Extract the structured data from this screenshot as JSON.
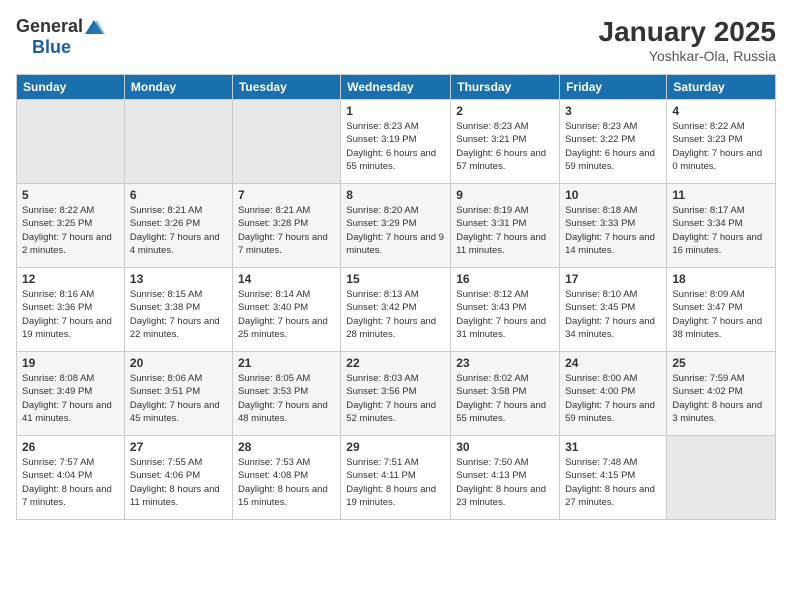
{
  "logo": {
    "general": "General",
    "blue": "Blue"
  },
  "title": "January 2025",
  "subtitle": "Yoshkar-Ola, Russia",
  "days_of_week": [
    "Sunday",
    "Monday",
    "Tuesday",
    "Wednesday",
    "Thursday",
    "Friday",
    "Saturday"
  ],
  "weeks": [
    [
      {
        "day": "",
        "sunrise": "",
        "sunset": "",
        "daylight": ""
      },
      {
        "day": "",
        "sunrise": "",
        "sunset": "",
        "daylight": ""
      },
      {
        "day": "",
        "sunrise": "",
        "sunset": "",
        "daylight": ""
      },
      {
        "day": "1",
        "sunrise": "Sunrise: 8:23 AM",
        "sunset": "Sunset: 3:19 PM",
        "daylight": "Daylight: 6 hours and 55 minutes."
      },
      {
        "day": "2",
        "sunrise": "Sunrise: 8:23 AM",
        "sunset": "Sunset: 3:21 PM",
        "daylight": "Daylight: 6 hours and 57 minutes."
      },
      {
        "day": "3",
        "sunrise": "Sunrise: 8:23 AM",
        "sunset": "Sunset: 3:22 PM",
        "daylight": "Daylight: 6 hours and 59 minutes."
      },
      {
        "day": "4",
        "sunrise": "Sunrise: 8:22 AM",
        "sunset": "Sunset: 3:23 PM",
        "daylight": "Daylight: 7 hours and 0 minutes."
      }
    ],
    [
      {
        "day": "5",
        "sunrise": "Sunrise: 8:22 AM",
        "sunset": "Sunset: 3:25 PM",
        "daylight": "Daylight: 7 hours and 2 minutes."
      },
      {
        "day": "6",
        "sunrise": "Sunrise: 8:21 AM",
        "sunset": "Sunset: 3:26 PM",
        "daylight": "Daylight: 7 hours and 4 minutes."
      },
      {
        "day": "7",
        "sunrise": "Sunrise: 8:21 AM",
        "sunset": "Sunset: 3:28 PM",
        "daylight": "Daylight: 7 hours and 7 minutes."
      },
      {
        "day": "8",
        "sunrise": "Sunrise: 8:20 AM",
        "sunset": "Sunset: 3:29 PM",
        "daylight": "Daylight: 7 hours and 9 minutes."
      },
      {
        "day": "9",
        "sunrise": "Sunrise: 8:19 AM",
        "sunset": "Sunset: 3:31 PM",
        "daylight": "Daylight: 7 hours and 11 minutes."
      },
      {
        "day": "10",
        "sunrise": "Sunrise: 8:18 AM",
        "sunset": "Sunset: 3:33 PM",
        "daylight": "Daylight: 7 hours and 14 minutes."
      },
      {
        "day": "11",
        "sunrise": "Sunrise: 8:17 AM",
        "sunset": "Sunset: 3:34 PM",
        "daylight": "Daylight: 7 hours and 16 minutes."
      }
    ],
    [
      {
        "day": "12",
        "sunrise": "Sunrise: 8:16 AM",
        "sunset": "Sunset: 3:36 PM",
        "daylight": "Daylight: 7 hours and 19 minutes."
      },
      {
        "day": "13",
        "sunrise": "Sunrise: 8:15 AM",
        "sunset": "Sunset: 3:38 PM",
        "daylight": "Daylight: 7 hours and 22 minutes."
      },
      {
        "day": "14",
        "sunrise": "Sunrise: 8:14 AM",
        "sunset": "Sunset: 3:40 PM",
        "daylight": "Daylight: 7 hours and 25 minutes."
      },
      {
        "day": "15",
        "sunrise": "Sunrise: 8:13 AM",
        "sunset": "Sunset: 3:42 PM",
        "daylight": "Daylight: 7 hours and 28 minutes."
      },
      {
        "day": "16",
        "sunrise": "Sunrise: 8:12 AM",
        "sunset": "Sunset: 3:43 PM",
        "daylight": "Daylight: 7 hours and 31 minutes."
      },
      {
        "day": "17",
        "sunrise": "Sunrise: 8:10 AM",
        "sunset": "Sunset: 3:45 PM",
        "daylight": "Daylight: 7 hours and 34 minutes."
      },
      {
        "day": "18",
        "sunrise": "Sunrise: 8:09 AM",
        "sunset": "Sunset: 3:47 PM",
        "daylight": "Daylight: 7 hours and 38 minutes."
      }
    ],
    [
      {
        "day": "19",
        "sunrise": "Sunrise: 8:08 AM",
        "sunset": "Sunset: 3:49 PM",
        "daylight": "Daylight: 7 hours and 41 minutes."
      },
      {
        "day": "20",
        "sunrise": "Sunrise: 8:06 AM",
        "sunset": "Sunset: 3:51 PM",
        "daylight": "Daylight: 7 hours and 45 minutes."
      },
      {
        "day": "21",
        "sunrise": "Sunrise: 8:05 AM",
        "sunset": "Sunset: 3:53 PM",
        "daylight": "Daylight: 7 hours and 48 minutes."
      },
      {
        "day": "22",
        "sunrise": "Sunrise: 8:03 AM",
        "sunset": "Sunset: 3:56 PM",
        "daylight": "Daylight: 7 hours and 52 minutes."
      },
      {
        "day": "23",
        "sunrise": "Sunrise: 8:02 AM",
        "sunset": "Sunset: 3:58 PM",
        "daylight": "Daylight: 7 hours and 55 minutes."
      },
      {
        "day": "24",
        "sunrise": "Sunrise: 8:00 AM",
        "sunset": "Sunset: 4:00 PM",
        "daylight": "Daylight: 7 hours and 59 minutes."
      },
      {
        "day": "25",
        "sunrise": "Sunrise: 7:59 AM",
        "sunset": "Sunset: 4:02 PM",
        "daylight": "Daylight: 8 hours and 3 minutes."
      }
    ],
    [
      {
        "day": "26",
        "sunrise": "Sunrise: 7:57 AM",
        "sunset": "Sunset: 4:04 PM",
        "daylight": "Daylight: 8 hours and 7 minutes."
      },
      {
        "day": "27",
        "sunrise": "Sunrise: 7:55 AM",
        "sunset": "Sunset: 4:06 PM",
        "daylight": "Daylight: 8 hours and 11 minutes."
      },
      {
        "day": "28",
        "sunrise": "Sunrise: 7:53 AM",
        "sunset": "Sunset: 4:08 PM",
        "daylight": "Daylight: 8 hours and 15 minutes."
      },
      {
        "day": "29",
        "sunrise": "Sunrise: 7:51 AM",
        "sunset": "Sunset: 4:11 PM",
        "daylight": "Daylight: 8 hours and 19 minutes."
      },
      {
        "day": "30",
        "sunrise": "Sunrise: 7:50 AM",
        "sunset": "Sunset: 4:13 PM",
        "daylight": "Daylight: 8 hours and 23 minutes."
      },
      {
        "day": "31",
        "sunrise": "Sunrise: 7:48 AM",
        "sunset": "Sunset: 4:15 PM",
        "daylight": "Daylight: 8 hours and 27 minutes."
      },
      {
        "day": "",
        "sunrise": "",
        "sunset": "",
        "daylight": ""
      }
    ]
  ]
}
